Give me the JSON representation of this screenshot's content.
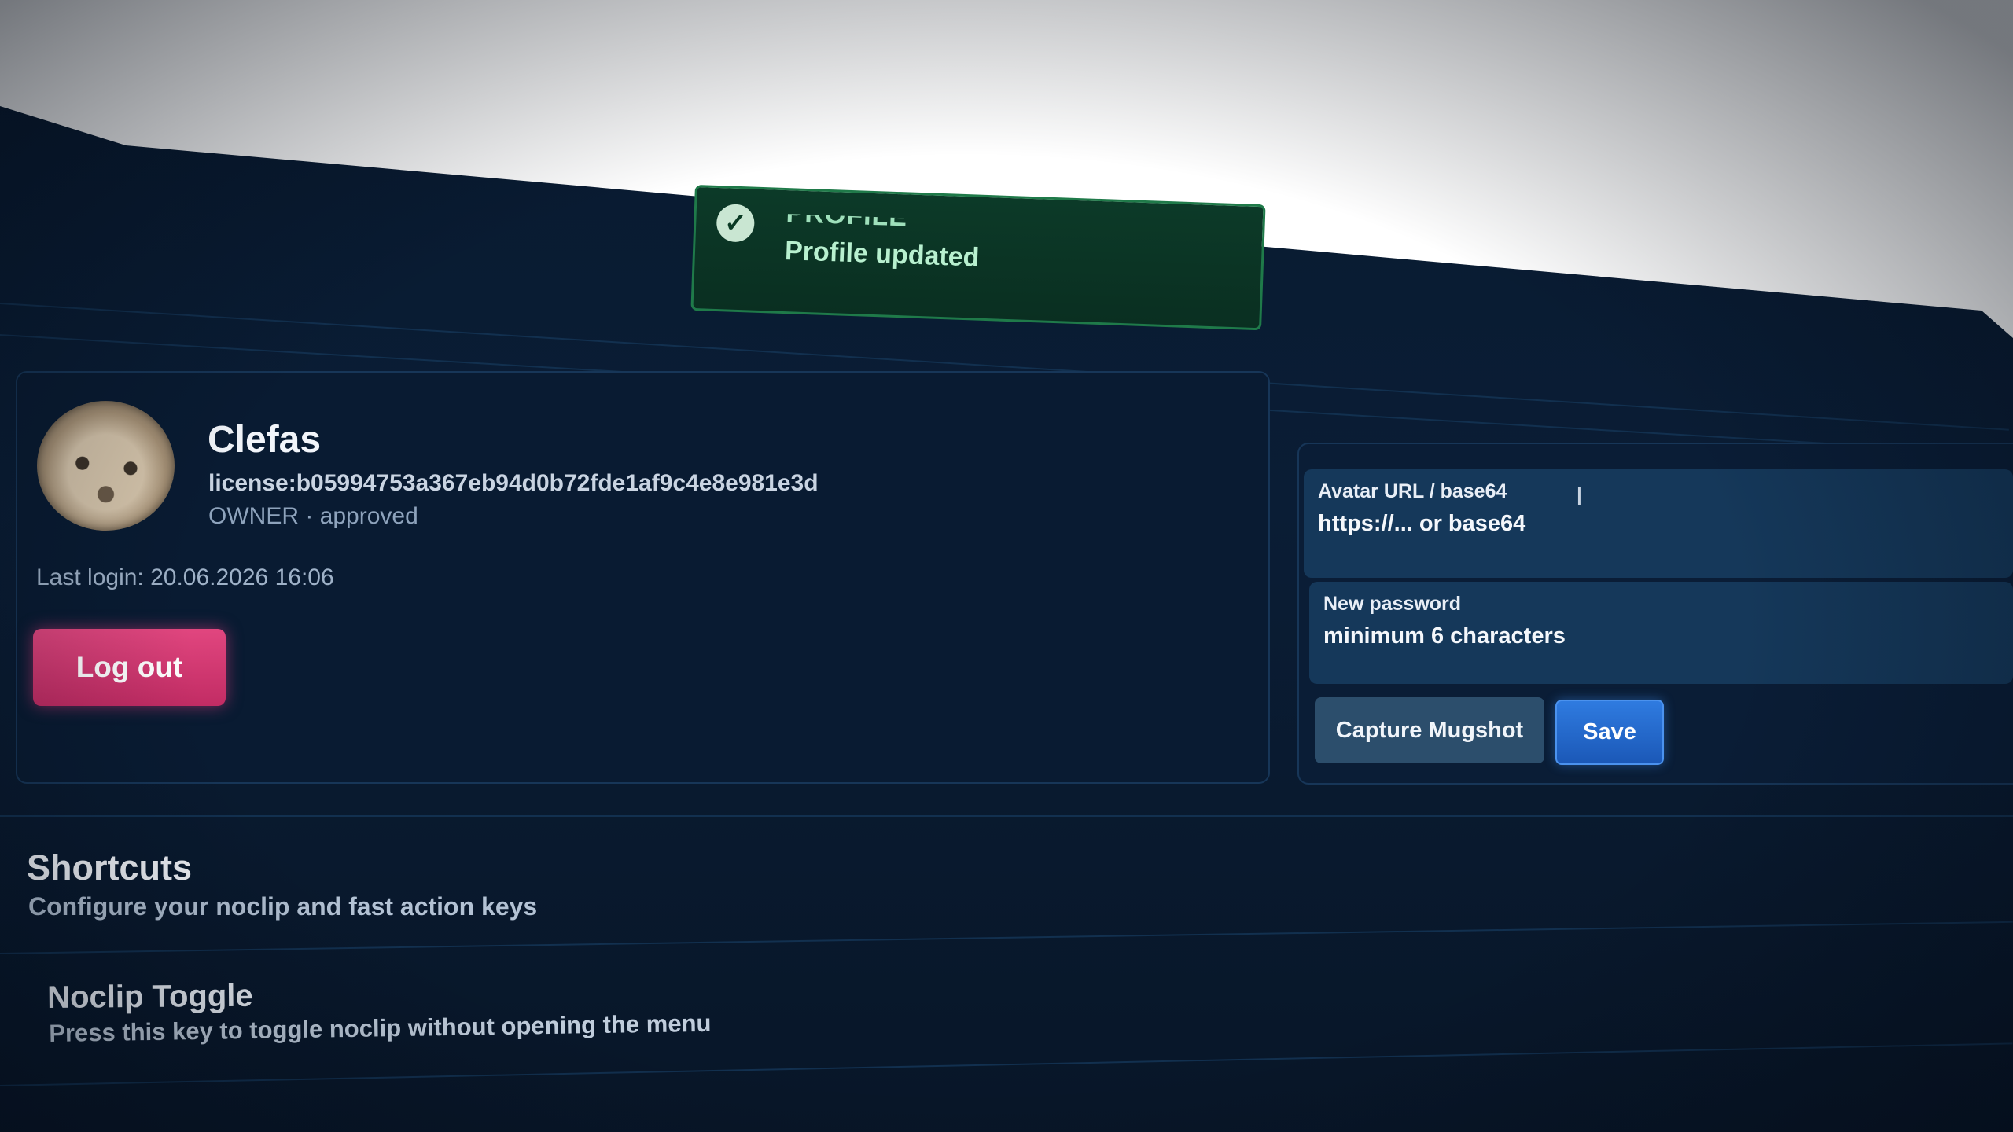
{
  "toast": {
    "title": "PROFILE",
    "message": "Profile updated"
  },
  "profile": {
    "username": "Clefas",
    "license": "license:b05994753a367eb94d0b72fde1af9c4e8e981e3d",
    "role_status": "OWNER · approved",
    "last_login": "Last login: 20.06.2026 16:06",
    "logout_label": "Log out"
  },
  "form": {
    "avatar_label": "Avatar URL / base64",
    "avatar_placeholder": "https://... or base64",
    "password_label": "New password",
    "password_placeholder": "minimum 6 characters",
    "capture_label": "Capture Mugshot",
    "save_label": "Save"
  },
  "shortcuts": {
    "title": "Shortcuts",
    "subtitle": "Configure your noclip and fast action keys",
    "items": [
      {
        "title": "Noclip Toggle",
        "description": "Press this key to toggle noclip without opening the menu"
      }
    ]
  },
  "colors": {
    "background": "#081a30",
    "accent_pink": "#d83a73",
    "accent_blue": "#2468cf",
    "toast_green": "#0c3a28"
  }
}
